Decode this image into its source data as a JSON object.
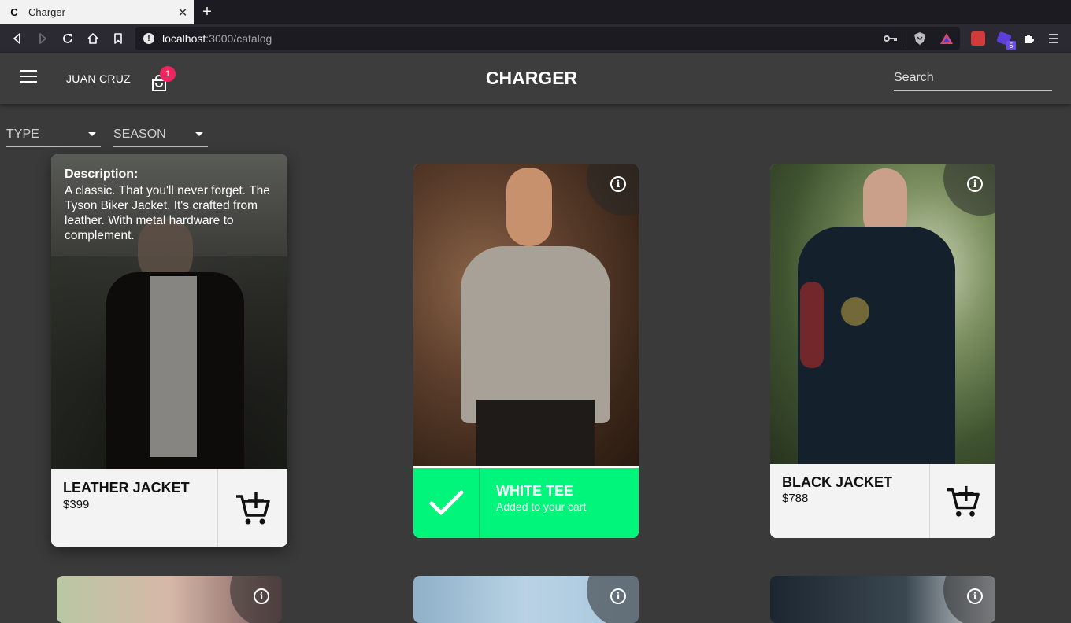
{
  "browser": {
    "tab_title": "Charger",
    "tab_favicon": "C",
    "url_host": "localhost",
    "url_path": ":3000/catalog",
    "extension_badge": "5"
  },
  "header": {
    "user_name": "JUAN CRUZ",
    "cart_count": "1",
    "brand": "CHARGER",
    "search_placeholder": "Search"
  },
  "filters": {
    "type_label": "TYPE",
    "season_label": "SEASON"
  },
  "products": [
    {
      "name": "LEATHER JACKET",
      "price": "$399",
      "description_label": "Description:",
      "description": "A classic. That you'll never forget. The Tyson Biker Jacket. It's crafted from leather. With metal hardware to complement."
    },
    {
      "name": "WHITE TEE",
      "confirmation": "Added to your cart"
    },
    {
      "name": "BLACK JACKET",
      "price": "$788"
    }
  ],
  "colors": {
    "accent_green": "#00f57a",
    "badge_pink": "#f0245f",
    "background": "#3a3a3a"
  }
}
